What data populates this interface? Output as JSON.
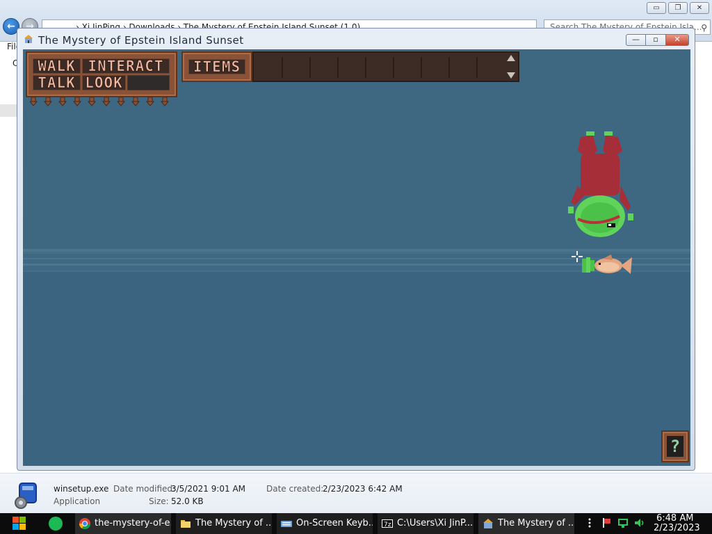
{
  "explorer": {
    "address_path": "›  Xi JinPing  ›  Downloads  ›  The Mystery of Epstein Island Sunset  (1.0)",
    "search_placeholder": "Search The Mystery of Epstein Isla...",
    "menu_file": "File",
    "left_fragment": "O",
    "caption": {
      "minimize": "▭",
      "restore": "❐",
      "close": "✕"
    },
    "details": {
      "file_name": "winsetup.exe",
      "file_type": "Application",
      "modified_label": "Date modified:",
      "modified_value": "3/5/2021 9:01 AM",
      "size_label": "Size:",
      "size_value": "52.0 KB",
      "created_label": "Date created:",
      "created_value": "2/23/2023 6:42 AM"
    }
  },
  "game_window": {
    "title": "The Mystery of Epstein Island Sunset",
    "caption": {
      "minimize": "—",
      "maximize": "▫",
      "close": "✕"
    }
  },
  "game": {
    "verbs": {
      "walk": "WALK",
      "interact": "INTERACT",
      "talk": "TALK",
      "look": "LOOK"
    },
    "items_label": "ITEMS",
    "help_label": "?",
    "colors": {
      "water": "#3f6882",
      "panel_wood": "#8a5236",
      "verb_text": "#f0b7a0"
    }
  },
  "taskbar": {
    "tasks": [
      {
        "label": "the-mystery-of-e...",
        "icon": "chrome-icon"
      },
      {
        "label": "The Mystery of ...",
        "icon": "folder-icon"
      },
      {
        "label": "On-Screen Keyb...",
        "icon": "keyboard-icon"
      },
      {
        "label": "C:\\Users\\Xi JinP...",
        "icon": "7zip-icon"
      },
      {
        "label": "The Mystery of ...",
        "icon": "game-window-icon"
      }
    ],
    "clock_time": "6:48 AM",
    "clock_date": "2/23/2023"
  }
}
